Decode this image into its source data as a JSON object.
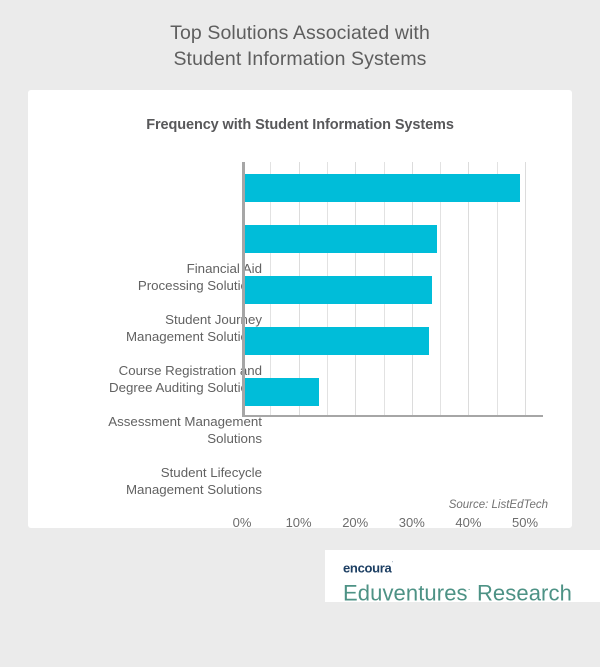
{
  "page_title": {
    "line1": "Top Solutions Associated with",
    "line2": "Student Information Systems"
  },
  "source_note": "Source: ListEdTech",
  "footer": {
    "brand_top": "encoura",
    "brand_top_mark": "˙",
    "brand_bottom": "Eduventures",
    "brand_bottom_mark": "·",
    "brand_bottom_suffix": " Research"
  },
  "colors": {
    "bar": "#00bdd9",
    "page_background": "#ebebeb",
    "card_background": "#ffffff",
    "axis": "#a6a6a6",
    "gridline": "#e2e2e2",
    "title_text": "#5e5e5e",
    "chart_title_text": "#58585a",
    "label_text": "#626262",
    "brand_navy": "#1d3f63",
    "brand_green": "#4d9285"
  },
  "chart_data": {
    "type": "bar",
    "orientation": "horizontal",
    "title": "Frequency with Student Information Systems",
    "xlabel": "",
    "ylabel": "",
    "categories": [
      "Financial Aid Processing Solutions",
      "Student Journey Management Solutions",
      "Course Registration and Degree Auditing Solutions",
      "Assessment Management Solutions",
      "Student Lifecycle Management Solutions"
    ],
    "category_lines": [
      [
        "Financial Aid",
        "Processing Solutions"
      ],
      [
        "Student Journey",
        "Management Solutions"
      ],
      [
        "Course Registration and",
        "Degree Auditing Solutions"
      ],
      [
        "Assessment Management",
        "Solutions"
      ],
      [
        "Student Lifecycle",
        "Management Solutions"
      ]
    ],
    "values": [
      48.5,
      34.0,
      33.0,
      32.5,
      13.0
    ],
    "value_labels": [
      "48.5%",
      "34.0%",
      "33.0%",
      "32.5%",
      "13.0%"
    ],
    "xlim": [
      0,
      53
    ],
    "xticks": [
      0,
      10,
      20,
      30,
      40,
      50
    ],
    "xtick_labels": [
      "0%",
      "10%",
      "20%",
      "30%",
      "40%",
      "50%"
    ],
    "minor_gridline_step": 5,
    "grid": true,
    "legend": false,
    "series_color": "#00bdd9",
    "source": "ListEdTech"
  }
}
